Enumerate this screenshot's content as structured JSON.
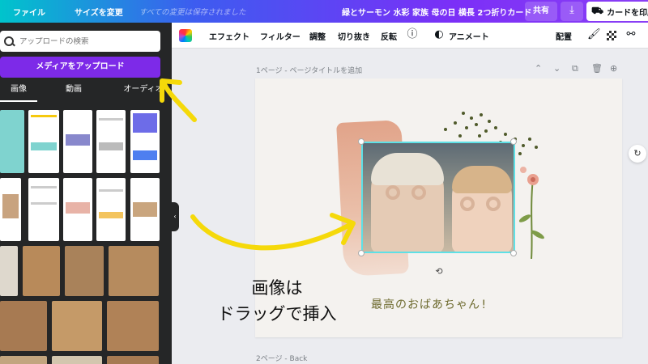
{
  "topbar": {
    "file_menu": "ファイル",
    "resize_menu": "サイズを変更",
    "save_status": "すべての変更は保存されました",
    "document_title": "緑とサーモン 水彩 家族 母の日 横長 2つ折りカード",
    "share_label": "共有",
    "print_label": "カードを印刷"
  },
  "sidebar": {
    "search_placeholder": "アップロードの検索",
    "upload_button": "メディアをアップロード",
    "tabs": [
      "画像",
      "動画",
      "オーディオ"
    ]
  },
  "toolbar": {
    "effects": "エフェクト",
    "filters": "フィルター",
    "adjust": "調整",
    "crop": "切り抜き",
    "flip": "反転",
    "animate": "アニメート",
    "position": "配置"
  },
  "canvas": {
    "page1_label": "1ページ - ページタイトルを追加",
    "page2_label": "2ページ - Back",
    "greeting_text": "最高のおばあちゃん!"
  },
  "annotation": {
    "line1": "画像は",
    "line2": "ドラッグで挿入"
  },
  "colors": {
    "accent_purple": "#7d2ae8",
    "selection_teal": "#5ee0e6",
    "annotation_arrow": "#f5d90a"
  }
}
